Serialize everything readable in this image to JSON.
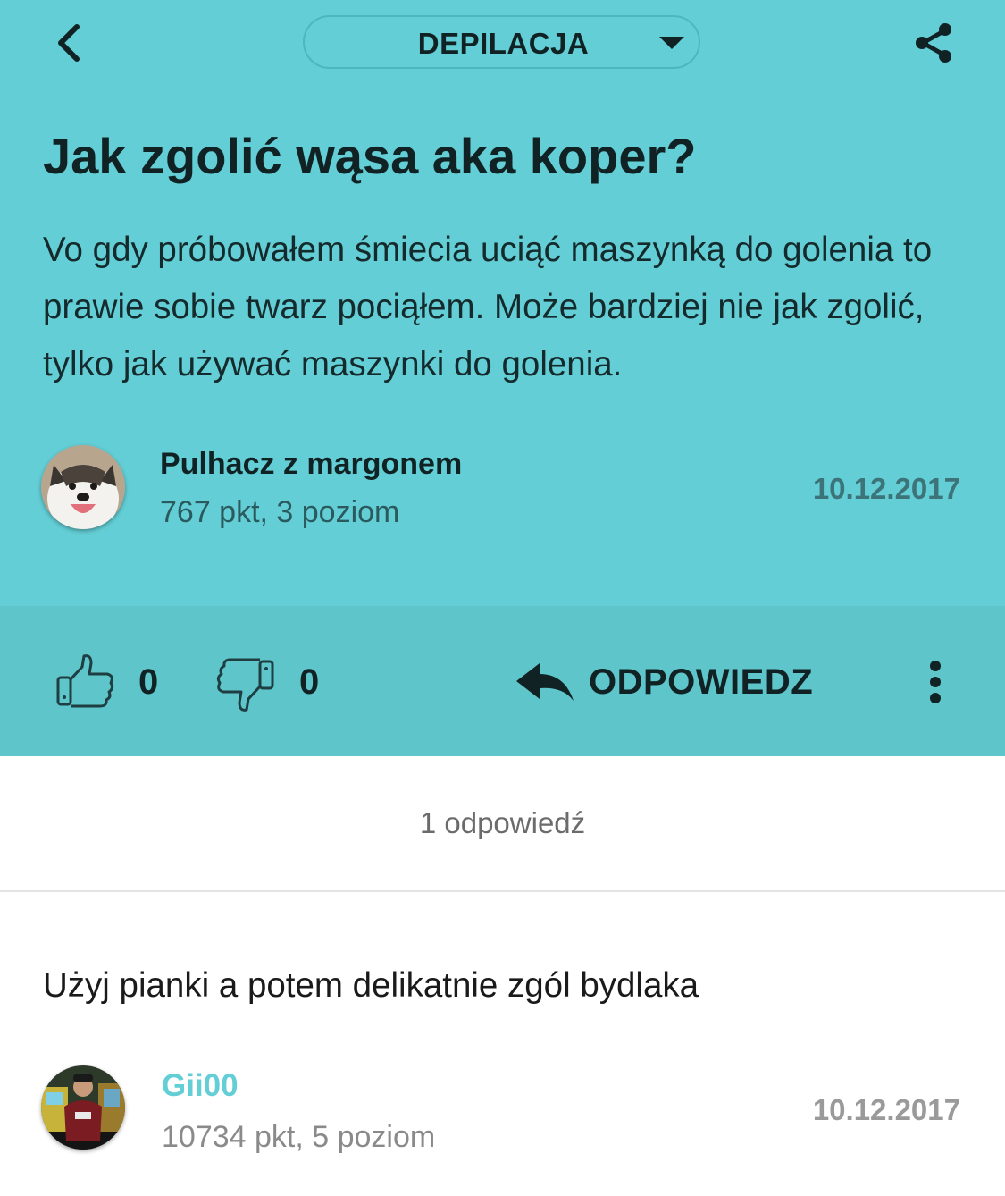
{
  "header": {
    "category": "DEPILACJA"
  },
  "question": {
    "title": "Jak zgolić wąsa aka koper?",
    "body": "Vo gdy próbowałem śmiecia uciąć maszynką do golenia to prawie sobie twarz pociąłem. Może bardziej nie jak zgolić, tylko jak używać maszynki do golenia.",
    "author": {
      "name": "Pulhacz z margonem",
      "meta": "767 pkt, 3 poziom",
      "avatar": "husky-dog-avatar"
    },
    "date": "10.12.2017"
  },
  "actions": {
    "likes": "0",
    "dislikes": "0",
    "reply_label": "ODPOWIEDZ"
  },
  "answers_count_label": "1 odpowiedź",
  "answers": [
    {
      "text": "Użyj pianki a potem delikatnie zgól bydlaka",
      "author": {
        "name": "Gii00",
        "meta": "10734 pkt, 5 poziom",
        "avatar": "person-photo-avatar"
      },
      "date": "10.12.2017"
    }
  ],
  "colors": {
    "header_bg": "#63ced5",
    "action_bar_bg": "#5ec5cb",
    "accent": "#63ced5",
    "text_dark": "#102224"
  }
}
